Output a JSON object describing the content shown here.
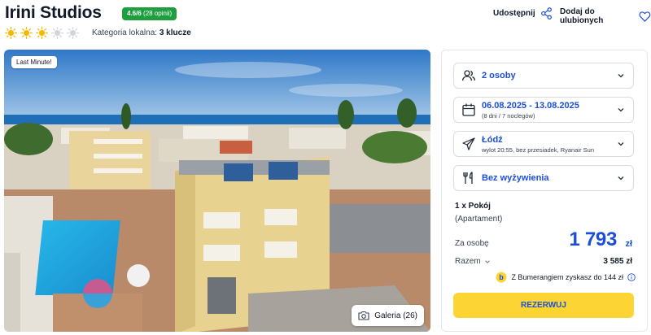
{
  "hotel": {
    "name": "Irini Studios",
    "rating_score": "4.6/6",
    "rating_count": "(28 opinii)",
    "stars_filled": 3,
    "stars_total": 5,
    "category_prefix": "Kategoria lokalna:",
    "category_value": "3 klucze"
  },
  "actions": {
    "share_label": "Udostępnij",
    "favorite_label": "Dodaj do ulubionych"
  },
  "photo": {
    "badge": "Last Minute!",
    "gallery_label": "Galeria (26)"
  },
  "booking": {
    "guests": "2 osoby",
    "dates": "06.08.2025 - 13.08.2025",
    "dates_sub": "(8 dni / 7 noclegów)",
    "departure_city": "Łódź",
    "flight_details": "wylot 20:55, bez przesiadek, Ryanair Sun",
    "board": "Bez wyżywienia",
    "room": "1 x Pokój",
    "room_type": "(Apartament)",
    "per_person_label": "Za osobę",
    "price_per_person": "1 793",
    "currency": "zł",
    "total_label": "Razem",
    "total_value": "3 585 zł",
    "bumerang_text": "Z Bumerangiem zyskasz do 144 zł",
    "reserve_label": "REZERWUJ"
  },
  "colors": {
    "accent_blue": "#1d4ed8",
    "rating_green": "#1e9e3e",
    "star_yellow": "#f5b800",
    "reserve_yellow": "#fcd535"
  }
}
